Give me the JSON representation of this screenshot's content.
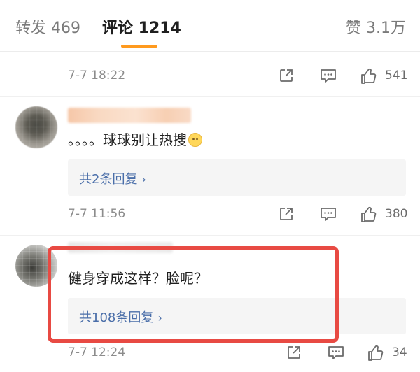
{
  "tabs": {
    "repost": "转发 469",
    "comment": "评论 1214",
    "like": "赞 3.1万"
  },
  "top_meta": {
    "time": "7-7 18:22",
    "likes": "541"
  },
  "comments": [
    {
      "text": "。。。。球球别让热搜",
      "emoji_icon": "sleeping-face-emoji",
      "replies": "共2条回复",
      "time": "7-7 11:56",
      "likes": "380"
    },
    {
      "text": "健身穿成这样？脸呢？",
      "replies": "共108条回复",
      "time": "7-7 12:24",
      "likes": "34"
    }
  ],
  "colors": {
    "accent_underline": "#ff9a1e",
    "link": "#4a6ea9",
    "highlight_box": "#e84a43"
  },
  "icons": [
    "share-icon",
    "comment-icon",
    "thumbs-up-icon",
    "chevron-right-icon"
  ]
}
